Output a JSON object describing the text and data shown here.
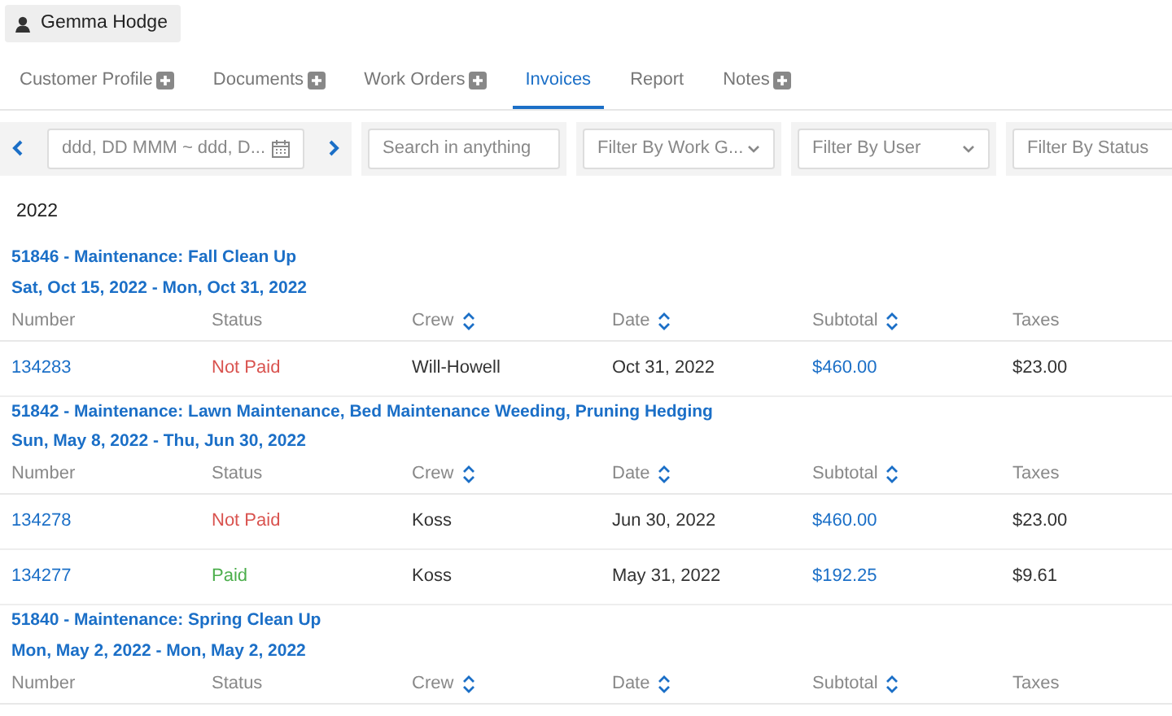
{
  "customer": {
    "name": "Gemma Hodge"
  },
  "tabs": [
    {
      "label": "Customer Profile",
      "has_add": true,
      "selected": false
    },
    {
      "label": "Documents",
      "has_add": true,
      "selected": false
    },
    {
      "label": "Work Orders",
      "has_add": true,
      "selected": false
    },
    {
      "label": "Invoices",
      "has_add": false,
      "selected": true
    },
    {
      "label": "Report",
      "has_add": false,
      "selected": false
    },
    {
      "label": "Notes",
      "has_add": true,
      "selected": false
    }
  ],
  "filters": {
    "date_range": {
      "placeholder": "ddd, DD MMM ~ ddd, D..."
    },
    "search": {
      "placeholder": "Search in anything"
    },
    "dropdowns": [
      {
        "placeholder": "Filter By Work G..."
      },
      {
        "placeholder": "Filter By User"
      },
      {
        "placeholder": "Filter By Status"
      }
    ]
  },
  "year": "2022",
  "work_orders": [
    {
      "title": "51846 - Maintenance: Fall Clean Up",
      "dates": "Sat, Oct 15, 2022 - Mon, Oct 31, 2022",
      "columns": [
        {
          "label": "Number",
          "sortable": false
        },
        {
          "label": "Status",
          "sortable": false
        },
        {
          "label": "Crew",
          "sortable": true
        },
        {
          "label": "Date",
          "sortable": true
        },
        {
          "label": "Subtotal",
          "sortable": true
        },
        {
          "label": "Taxes",
          "sortable": false
        }
      ],
      "invoices": [
        {
          "number": "134283",
          "status": "Not Paid",
          "paid": false,
          "crew": "Will-Howell",
          "date": "Oct 31, 2022",
          "subtotal": "$460.00",
          "taxes": "$23.00"
        }
      ]
    },
    {
      "title": "51842 - Maintenance: Lawn Maintenance, Bed Maintenance Weeding, Pruning Hedging",
      "dates": "Sun, May 8, 2022 - Thu, Jun 30, 2022",
      "columns": [
        {
          "label": "Number",
          "sortable": false
        },
        {
          "label": "Status",
          "sortable": false
        },
        {
          "label": "Crew",
          "sortable": true
        },
        {
          "label": "Date",
          "sortable": true
        },
        {
          "label": "Subtotal",
          "sortable": true
        },
        {
          "label": "Taxes",
          "sortable": false
        }
      ],
      "invoices": [
        {
          "number": "134278",
          "status": "Not Paid",
          "paid": false,
          "crew": "Koss",
          "date": "Jun 30, 2022",
          "subtotal": "$460.00",
          "taxes": "$23.00"
        },
        {
          "number": "134277",
          "status": "Paid",
          "paid": true,
          "crew": "Koss",
          "date": "May 31, 2022",
          "subtotal": "$192.25",
          "taxes": "$9.61"
        }
      ]
    },
    {
      "title": "51840 - Maintenance: Spring Clean Up",
      "dates": "Mon, May 2, 2022 - Mon, May 2, 2022",
      "columns": [
        {
          "label": "Number",
          "sortable": false
        },
        {
          "label": "Status",
          "sortable": false
        },
        {
          "label": "Crew",
          "sortable": true
        },
        {
          "label": "Date",
          "sortable": true
        },
        {
          "label": "Subtotal",
          "sortable": true
        },
        {
          "label": "Taxes",
          "sortable": false
        }
      ]
    }
  ]
}
